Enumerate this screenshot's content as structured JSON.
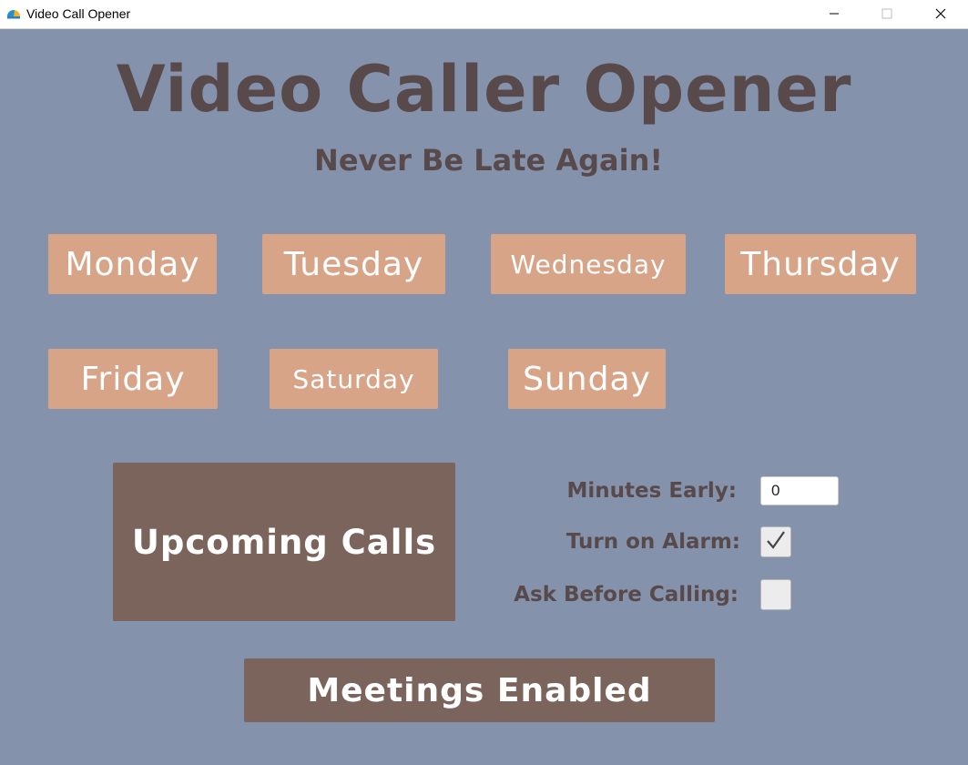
{
  "window": {
    "title": "Video Call Opener",
    "icon": "app-icon",
    "controls": [
      "minimize-icon",
      "maximize-icon",
      "close-icon"
    ]
  },
  "header": {
    "title": "Video Caller Opener",
    "subtitle": "Never Be Late Again!"
  },
  "days": [
    {
      "label": "Monday"
    },
    {
      "label": "Tuesday"
    },
    {
      "label": "Wednesday"
    },
    {
      "label": "Thursday"
    },
    {
      "label": "Friday"
    },
    {
      "label": "Saturday"
    },
    {
      "label": "Sunday"
    }
  ],
  "upcoming": {
    "label": "Upcoming Calls"
  },
  "settings": {
    "minutes_early_label": "Minutes Early:",
    "minutes_early_value": "0",
    "alarm_label": "Turn on Alarm:",
    "alarm_checked": true,
    "ask_label": "Ask Before Calling:",
    "ask_checked": false
  },
  "meetings": {
    "label": "Meetings Enabled"
  },
  "colors": {
    "background": "#8592ac",
    "day_button": "#d8a488",
    "dark_button": "#7a645c",
    "heading_text": "#584a4b"
  }
}
